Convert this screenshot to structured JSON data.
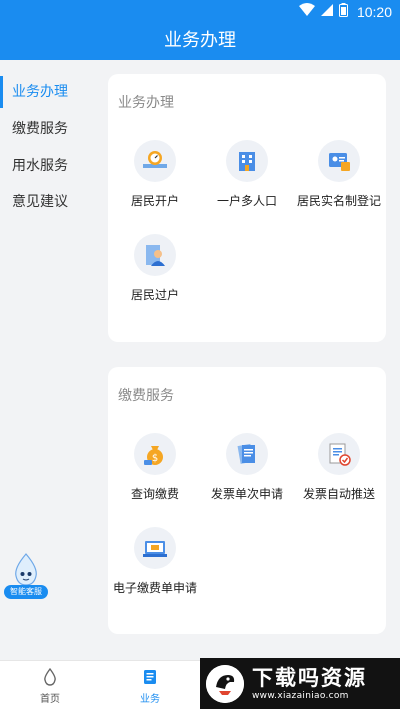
{
  "status_bar": {
    "time": "10:20",
    "icons": [
      "wifi-icon",
      "signal-icon",
      "battery-icon"
    ]
  },
  "app_bar": {
    "title": "业务办理"
  },
  "sidebar": {
    "items": [
      {
        "label": "业务办理",
        "active": true
      },
      {
        "label": "缴费服务",
        "active": false
      },
      {
        "label": "用水服务",
        "active": false
      },
      {
        "label": "意见建议",
        "active": false
      }
    ]
  },
  "sections": [
    {
      "title": "业务办理",
      "tiles": [
        {
          "label": "居民开户",
          "icon": "water-meter-icon"
        },
        {
          "label": "一户多人口",
          "icon": "building-icon"
        },
        {
          "label": "居民实名制登记",
          "icon": "id-card-icon"
        },
        {
          "label": "居民过户",
          "icon": "transfer-user-icon"
        }
      ]
    },
    {
      "title": "缴费服务",
      "tiles": [
        {
          "label": "查询缴费",
          "icon": "money-bag-icon"
        },
        {
          "label": "发票单次申请",
          "icon": "invoice-icon"
        },
        {
          "label": "发票自动推送",
          "icon": "auto-invoice-icon"
        },
        {
          "label": "电子缴费单申请",
          "icon": "e-bill-icon"
        }
      ]
    }
  ],
  "assistant": {
    "label": "智能客服"
  },
  "bottom_nav": {
    "items": [
      {
        "label": "首页",
        "active": false
      },
      {
        "label": "业务",
        "active": true
      }
    ]
  },
  "watermark": {
    "title": "下载吗资源",
    "url": "www.xiazainiao.com"
  },
  "colors": {
    "primary": "#1a8cf0",
    "background": "#f2f3f5",
    "card": "#ffffff"
  }
}
